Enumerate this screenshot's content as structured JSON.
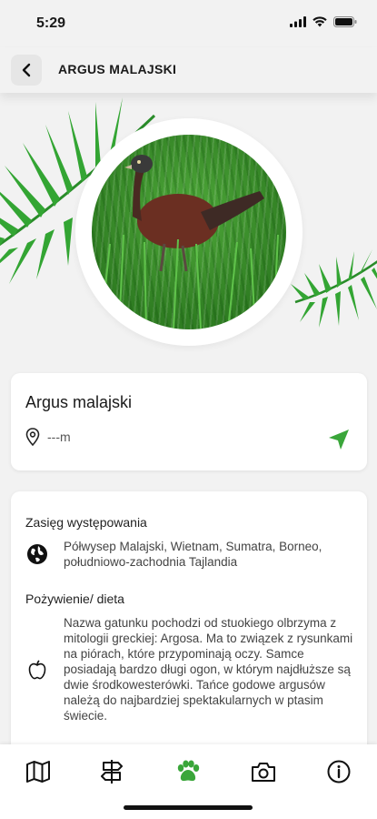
{
  "status": {
    "time": "5:29"
  },
  "header": {
    "title": "ARGUS MALAJSKI"
  },
  "animal": {
    "name": "Argus malajski",
    "distance": "---m"
  },
  "range": {
    "title": "Zasięg występowania",
    "text": "Półwysep Malajski, Wietnam, Sumatra, Borneo, południowo-zachodnia Tajlandia"
  },
  "diet": {
    "title": "Pożywienie/ dieta",
    "text": "Nazwa gatunku pochodzi od stuokiego olbrzyma z mitologii greckiej: Argosa. Ma to związek z rysunkami na piórach, które przypominają oczy. Samce posiadają bardzo długi ogon, w którym najdłuższe są dwie środkowesterówki. Tańce godowe argusów należą do najbardziej spektakularnych w ptasim świecie."
  },
  "colors": {
    "accent": "#3aa63a",
    "text": "#1a1a1a"
  },
  "tabs": [
    {
      "icon": "map-icon",
      "active": false
    },
    {
      "icon": "signpost-icon",
      "active": false
    },
    {
      "icon": "paw-icon",
      "active": true
    },
    {
      "icon": "camera-icon",
      "active": false
    },
    {
      "icon": "info-icon",
      "active": false
    }
  ]
}
